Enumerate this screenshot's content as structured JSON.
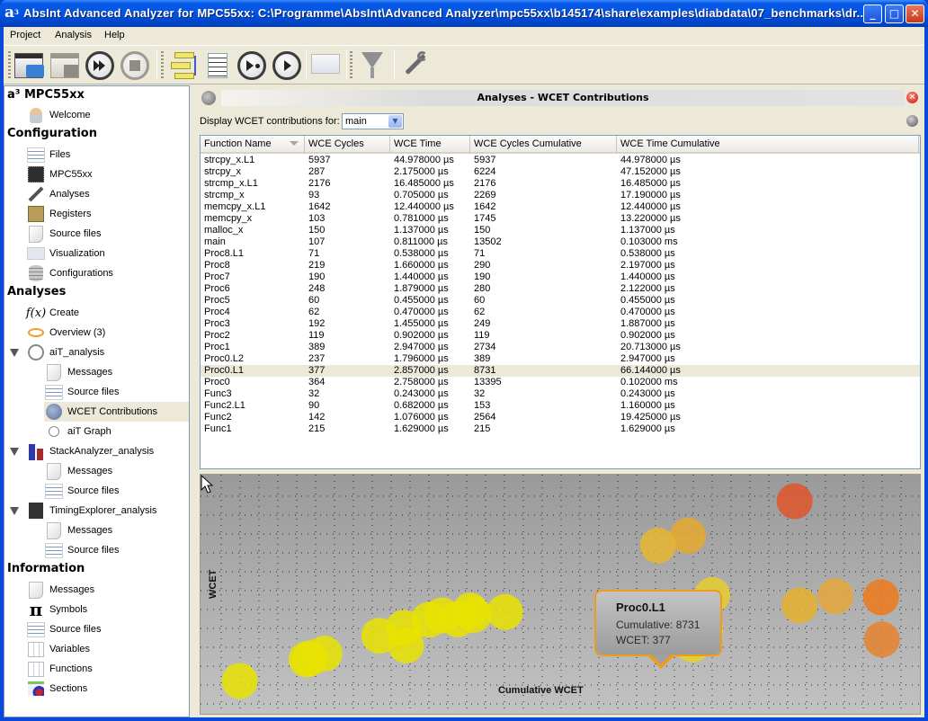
{
  "window": {
    "title": "AbsInt Advanced Analyzer for MPC55xx: C:\\Programme\\AbsInt\\Advanced Analyzer\\mpc55xx\\b145174\\share\\examples\\diabdata\\07_benchmarks\\dr...",
    "app_icon_glyph": "a",
    "buttons": {
      "minimize": "_",
      "maximize": "□",
      "close": "✕"
    }
  },
  "menu": [
    "Project",
    "Analysis",
    "Help"
  ],
  "toolbar": {
    "buttons": [
      {
        "name": "open-project",
        "icon": "folder-window-icon"
      },
      {
        "name": "save-project",
        "icon": "floppy-window-icon",
        "disabled": true
      },
      {
        "name": "run-all",
        "icon": "fast-forward-icon"
      },
      {
        "name": "stop",
        "icon": "stop-icon",
        "disabled": true
      },
      {
        "name": "call-graph",
        "icon": "graph-icon"
      },
      {
        "name": "report",
        "icon": "list-icon"
      },
      {
        "name": "step",
        "icon": "play-dot-icon"
      },
      {
        "name": "run",
        "icon": "play-icon"
      },
      {
        "name": "presentation",
        "icon": "projector-screen-icon",
        "disabled": true
      },
      {
        "name": "filter",
        "icon": "funnel-icon"
      },
      {
        "name": "settings",
        "icon": "wrench-icon"
      }
    ]
  },
  "sidebar": {
    "root": "a³ MPC55xx",
    "welcome": "Welcome",
    "sections": {
      "configuration": "Configuration",
      "analyses": "Analyses",
      "information": "Information"
    },
    "configuration_items": [
      "Files",
      "MPC55xx",
      "Analyses",
      "Registers",
      "Source files",
      "Visualization",
      "Configurations"
    ],
    "analyses_items": [
      "Create",
      "Overview (3)"
    ],
    "ait_analysis": {
      "label": "aiT_analysis",
      "children": [
        "Messages",
        "Source files",
        "WCET Contributions",
        "aiT Graph"
      ],
      "selected": "WCET Contributions"
    },
    "stack_analysis": {
      "label": "StackAnalyzer_analysis",
      "children": [
        "Messages",
        "Source files"
      ]
    },
    "timing_analysis": {
      "label": "TimingExplorer_analysis",
      "children": [
        "Messages",
        "Source files"
      ]
    },
    "information_items": [
      "Messages",
      "Symbols",
      "Source files",
      "Variables",
      "Functions",
      "Sections"
    ]
  },
  "panel": {
    "title": "Analyses - WCET Contributions",
    "display_label": "Display WCET contributions for:",
    "display_value": "main",
    "table": {
      "columns": [
        "Function Name",
        "WCE Cycles",
        "WCE Time",
        "WCE Cycles Cumulative",
        "WCE Time Cumulative"
      ],
      "sorted_column": "Function Name",
      "selected_row": "Proc0.L1",
      "rows": [
        [
          "strcpy_x.L1",
          "5937",
          "44.978000 µs",
          "5937",
          "44.978000 µs"
        ],
        [
          "strcpy_x",
          "287",
          "2.175000 µs",
          "6224",
          "47.152000 µs"
        ],
        [
          "strcmp_x.L1",
          "2176",
          "16.485000 µs",
          "2176",
          "16.485000 µs"
        ],
        [
          "strcmp_x",
          "93",
          "0.705000 µs",
          "2269",
          "17.190000 µs"
        ],
        [
          "memcpy_x.L1",
          "1642",
          "12.440000 µs",
          "1642",
          "12.440000 µs"
        ],
        [
          "memcpy_x",
          "103",
          "0.781000 µs",
          "1745",
          "13.220000 µs"
        ],
        [
          "malloc_x",
          "150",
          "1.137000 µs",
          "150",
          "1.137000 µs"
        ],
        [
          "main",
          "107",
          "0.811000 µs",
          "13502",
          "0.103000 ms"
        ],
        [
          "Proc8.L1",
          "71",
          "0.538000 µs",
          "71",
          "0.538000 µs"
        ],
        [
          "Proc8",
          "219",
          "1.660000 µs",
          "290",
          "2.197000 µs"
        ],
        [
          "Proc7",
          "190",
          "1.440000 µs",
          "190",
          "1.440000 µs"
        ],
        [
          "Proc6",
          "248",
          "1.879000 µs",
          "280",
          "2.122000 µs"
        ],
        [
          "Proc5",
          "60",
          "0.455000 µs",
          "60",
          "0.455000 µs"
        ],
        [
          "Proc4",
          "62",
          "0.470000 µs",
          "62",
          "0.470000 µs"
        ],
        [
          "Proc3",
          "192",
          "1.455000 µs",
          "249",
          "1.887000 µs"
        ],
        [
          "Proc2",
          "119",
          "0.902000 µs",
          "119",
          "0.902000 µs"
        ],
        [
          "Proc1",
          "389",
          "2.947000 µs",
          "2734",
          "20.713000 µs"
        ],
        [
          "Proc0.L2",
          "237",
          "1.796000 µs",
          "389",
          "2.947000 µs"
        ],
        [
          "Proc0.L1",
          "377",
          "2.857000 µs",
          "8731",
          "66.144000 µs"
        ],
        [
          "Proc0",
          "364",
          "2.758000 µs",
          "13395",
          "0.102000 ms"
        ],
        [
          "Func3",
          "32",
          "0.243000 µs",
          "32",
          "0.243000 µs"
        ],
        [
          "Func2.L1",
          "90",
          "0.682000 µs",
          "153",
          "1.160000 µs"
        ],
        [
          "Func2",
          "142",
          "1.076000 µs",
          "2564",
          "19.425000 µs"
        ],
        [
          "Func1",
          "215",
          "1.629000 µs",
          "215",
          "1.629000 µs"
        ]
      ]
    }
  },
  "chart_data": {
    "type": "scatter",
    "title": "",
    "xlabel": "Cumulative WCET",
    "ylabel": "WCET",
    "grid": true,
    "xlim": [
      0,
      14000
    ],
    "ylim": [
      0,
      6500
    ],
    "points": [
      {
        "name": "strcpy_x.L1",
        "x": 5937,
        "y": 5937,
        "color": "#e0552c"
      },
      {
        "name": "strcpy_x",
        "x": 6224,
        "y": 287,
        "color": "#e4b02e"
      },
      {
        "name": "strcmp_x.L1",
        "x": 2176,
        "y": 2176,
        "color": "#e5a92f"
      },
      {
        "name": "strcmp_x",
        "x": 2269,
        "y": 93,
        "color": "#e7d22a"
      },
      {
        "name": "memcpy_x.L1",
        "x": 1642,
        "y": 1642,
        "color": "#e6b630"
      },
      {
        "name": "memcpy_x",
        "x": 1745,
        "y": 103,
        "color": "#e5d12c"
      },
      {
        "name": "malloc_x",
        "x": 150,
        "y": 150,
        "color": "#e8e300"
      },
      {
        "name": "main",
        "x": 13502,
        "y": 107,
        "color": "#e6822e"
      },
      {
        "name": "Proc8.L1",
        "x": 71,
        "y": 71,
        "color": "#e8e300"
      },
      {
        "name": "Proc8",
        "x": 290,
        "y": 219,
        "color": "#e8e300"
      },
      {
        "name": "Proc7",
        "x": 190,
        "y": 190,
        "color": "#e8e300"
      },
      {
        "name": "Proc6",
        "x": 280,
        "y": 248,
        "color": "#e8e300"
      },
      {
        "name": "Proc5",
        "x": 60,
        "y": 60,
        "color": "#e8e300"
      },
      {
        "name": "Proc4",
        "x": 62,
        "y": 62,
        "color": "#e8e300"
      },
      {
        "name": "Proc3",
        "x": 249,
        "y": 192,
        "color": "#e8e300"
      },
      {
        "name": "Proc2",
        "x": 119,
        "y": 119,
        "color": "#e8e300"
      },
      {
        "name": "Proc1",
        "x": 2734,
        "y": 389,
        "color": "#e6cd2c"
      },
      {
        "name": "Proc0.L2",
        "x": 389,
        "y": 237,
        "color": "#e8e300"
      },
      {
        "name": "Proc0.L1",
        "x": 8731,
        "y": 377,
        "color": "#e4a73a"
      },
      {
        "name": "Proc0",
        "x": 13395,
        "y": 364,
        "color": "#ee7a1c"
      },
      {
        "name": "Func3",
        "x": 32,
        "y": 32,
        "color": "#e8e300"
      },
      {
        "name": "Func2.L1",
        "x": 153,
        "y": 90,
        "color": "#e8e300"
      },
      {
        "name": "Func2",
        "x": 2564,
        "y": 142,
        "color": "#e6d12c"
      },
      {
        "name": "Func1",
        "x": 215,
        "y": 215,
        "color": "#e8e300"
      }
    ],
    "tooltip": {
      "title": "Proc0.L1",
      "cumulative_label": "Cumulative: 8731",
      "wcet_label": "WCET: 377"
    }
  }
}
